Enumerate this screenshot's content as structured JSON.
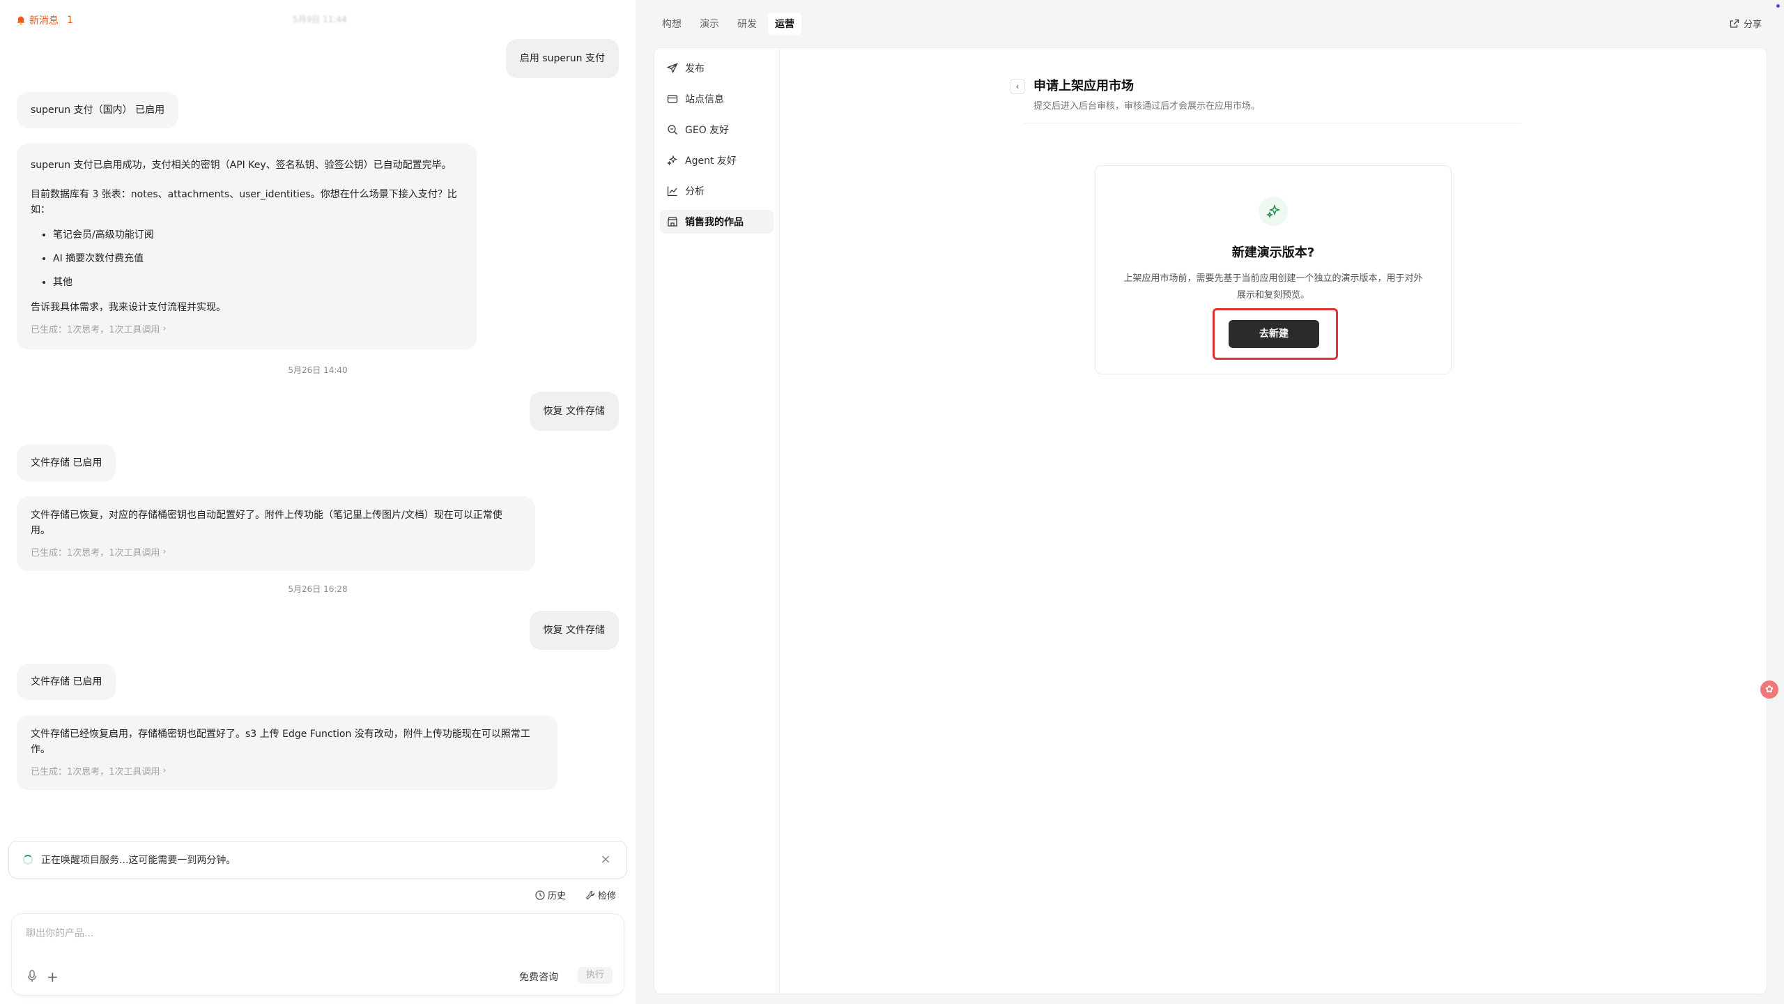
{
  "notification": {
    "label": "新消息",
    "count": "1",
    "top_time": "5月9日 11:44"
  },
  "messages": {
    "m1_user": "启用 superun 支付",
    "m2_ai": "superun 支付（国内） 已启用",
    "m3_ai": {
      "p1": "superun 支付已启用成功，支付相关的密钥（API Key、签名私钥、验签公钥）已自动配置完毕。",
      "p2": "目前数据库有 3 张表：notes、attachments、user_identities。你想在什么场景下接入支付？比如：",
      "items": [
        "笔记会员/高级功能订阅",
        "AI 摘要次数付费充值",
        "其他"
      ],
      "p3": "告诉我具体需求，我来设计支付流程并实现。",
      "meta": "已生成：1次思考，1次工具调用"
    },
    "date1": "5月26日 14:40",
    "m4_user": "恢复 文件存储",
    "m5_ai": "文件存储 已启用",
    "m6_ai": {
      "p1": "文件存储已恢复，对应的存储桶密钥也自动配置好了。附件上传功能（笔记里上传图片/文档）现在可以正常使用。",
      "meta": "已生成：1次思考，1次工具调用"
    },
    "date2": "5月26日 16:28",
    "m7_user": "恢复 文件存储",
    "m8_ai": "文件存储 已启用",
    "m9_ai": {
      "p1": "文件存储已经恢复启用，存储桶密钥也配置好了。s3 上传 Edge Function 没有改动，附件上传功能现在可以照常工作。",
      "meta": "已生成：1次思考，1次工具调用"
    }
  },
  "wake_bar": {
    "text": "正在唤醒项目服务...这可能需要一到两分钟。"
  },
  "history_bar": {
    "history": "历史",
    "repair": "检修"
  },
  "composer": {
    "placeholder": "聊出你的产品...",
    "free_consult": "免费咨询",
    "run": "执行"
  },
  "top_tabs": [
    "构想",
    "演示",
    "研发",
    "运营"
  ],
  "share_label": "分享",
  "side_nav": [
    "发布",
    "站点信息",
    "GEO 友好",
    "Agent 友好",
    "分析",
    "销售我的作品"
  ],
  "detail": {
    "title": "申请上架应用市场",
    "subtitle": "提交后进入后台审核，审核通过后才会展示在应用市场。"
  },
  "card": {
    "title": "新建演示版本?",
    "desc": "上架应用市场前，需要先基于当前应用创建一个独立的演示版本，用于对外展示和复刻预览。",
    "button": "去新建"
  },
  "colors": {
    "accent_orange": "#f05a1a",
    "highlight_red": "#e03131",
    "button_dark": "#2b2b2b"
  }
}
